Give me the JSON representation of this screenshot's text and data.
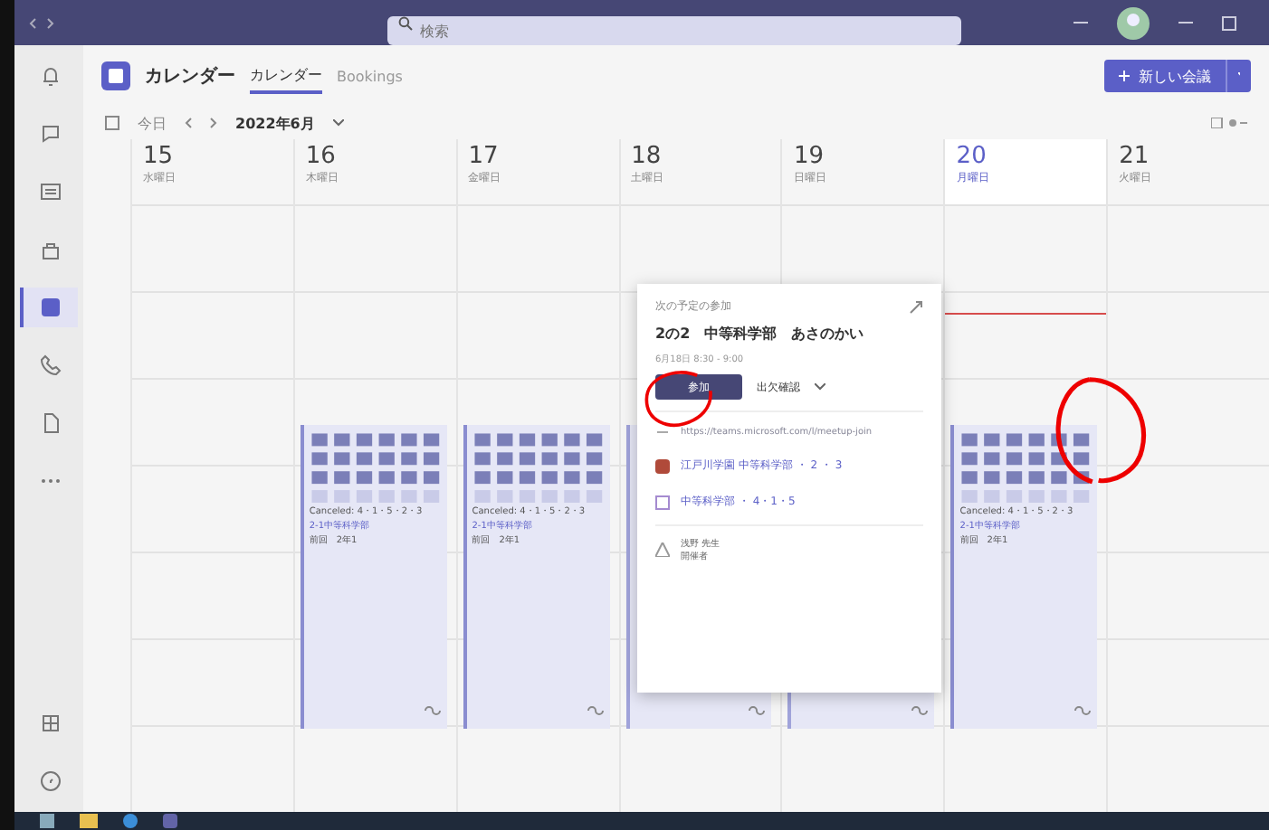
{
  "search": {
    "placeholder": "検索"
  },
  "rail": [
    {
      "kind": "bell",
      "selected": false
    },
    {
      "kind": "chat",
      "selected": false
    },
    {
      "kind": "teams",
      "selected": false
    },
    {
      "kind": "bag",
      "selected": false
    },
    {
      "kind": "calendar",
      "selected": true
    },
    {
      "kind": "phone",
      "selected": false
    },
    {
      "kind": "file",
      "selected": false
    },
    {
      "kind": "more",
      "selected": false
    },
    {
      "kind": "apps",
      "selected": false
    },
    {
      "kind": "help",
      "selected": false
    }
  ],
  "app": {
    "title": "カレンダー",
    "tabs": [
      {
        "label": "カレンダー",
        "selected": true
      },
      {
        "label": "Bookings",
        "selected": false
      }
    ],
    "new_meeting": "新しい会議"
  },
  "toolbar": {
    "today": "今日",
    "month": "2022年6月"
  },
  "days": [
    {
      "date": "15",
      "weekday": "水曜日",
      "today": false
    },
    {
      "date": "16",
      "weekday": "木曜日",
      "today": false,
      "events": [
        {
          "lines": [
            "Canceled: 4・1・5・2・3",
            "2-1中等科学部",
            "前回　2年1"
          ]
        }
      ]
    },
    {
      "date": "17",
      "weekday": "金曜日",
      "today": false,
      "events": [
        {
          "lines": [
            "Canceled: 4・1・5・2・3",
            "2-1中等科学部",
            "前回　2年1"
          ]
        }
      ]
    },
    {
      "date": "18",
      "weekday": "土曜日",
      "today": false,
      "events": [
        {
          "kind": "covered"
        }
      ]
    },
    {
      "date": "19",
      "weekday": "日曜日",
      "today": false,
      "events": [
        {
          "kind": "covered"
        }
      ]
    },
    {
      "date": "20",
      "weekday": "月曜日",
      "today": true,
      "events": [
        {
          "lines": [
            "Canceled: 4・1・5・2・3",
            "2-1中等科学部",
            "前回　2年1"
          ]
        }
      ]
    },
    {
      "date": "21",
      "weekday": "火曜日",
      "today": false
    }
  ],
  "popup": {
    "header": "次の予定の参加",
    "title": "2の2　中等科学部　あさのかい",
    "time": "6月18日 8:30 - 9:00",
    "join": "参加",
    "rsvp": "出欠確認",
    "link": "https://teams.microsoft.com/l/meetup-join",
    "items": [
      {
        "kind": "channel",
        "text": "江戸川学園 中等科学部 ・ 2 ・ 3"
      },
      {
        "kind": "calendar",
        "text": "中等科学部 ・ 4・1・5"
      }
    ],
    "organizer": {
      "name": "浅野 先生",
      "role": "開催者"
    }
  }
}
